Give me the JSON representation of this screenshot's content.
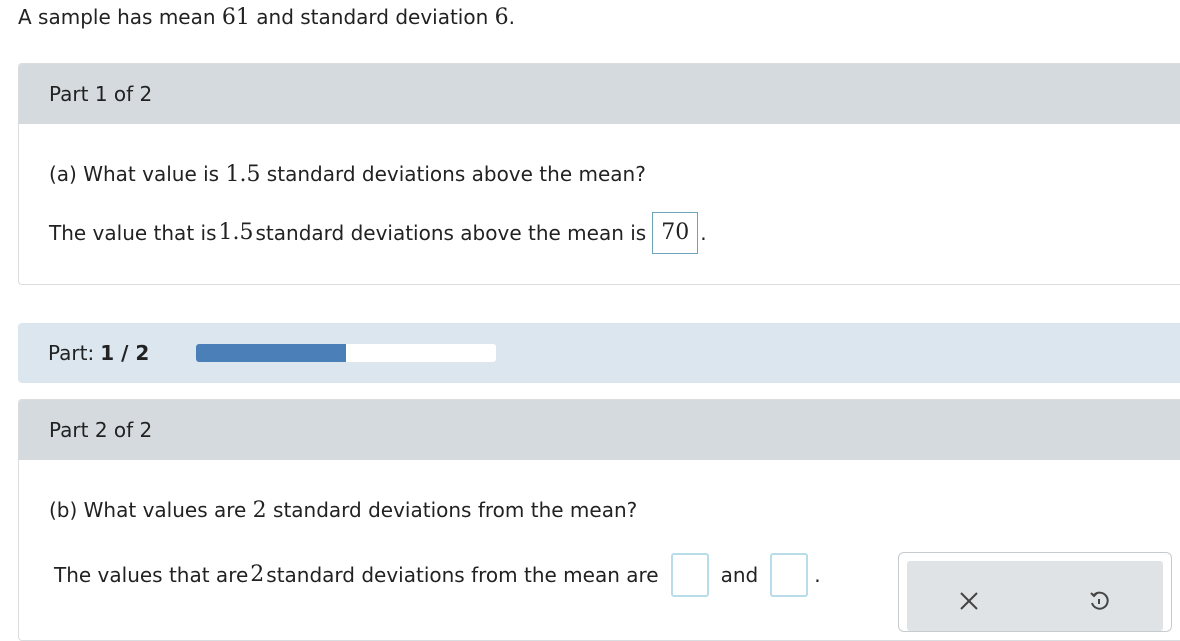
{
  "problem": {
    "intro_prefix": "A sample has mean ",
    "mean": "61",
    "intro_middle": " and standard deviation ",
    "sd": "6",
    "intro_suffix": "."
  },
  "part1": {
    "header": "Part 1 of 2",
    "question_prefix": "(a) What value is ",
    "question_num": "1.5",
    "question_suffix": " standard deviations above the mean?",
    "answer_prefix": "The value that is ",
    "answer_num": "1.5",
    "answer_middle": " standard deviations above the mean is",
    "answer_value": "70",
    "answer_suffix": "."
  },
  "progress": {
    "label": "Part:",
    "current": "1 / 2",
    "fraction": 0.5,
    "fill_color": "#4a7fb8"
  },
  "part2": {
    "header": "Part 2 of 2",
    "question_prefix": "(b) What values are ",
    "question_num": "2",
    "question_suffix": " standard deviations from the mean?",
    "answer_prefix": "The values that are ",
    "answer_num": "2",
    "answer_middle": " standard deviations from the mean are",
    "and_label": "and",
    "answer_suffix": "."
  },
  "toolbar": {
    "clear_icon": "close-icon",
    "undo_icon": "undo-icon"
  }
}
